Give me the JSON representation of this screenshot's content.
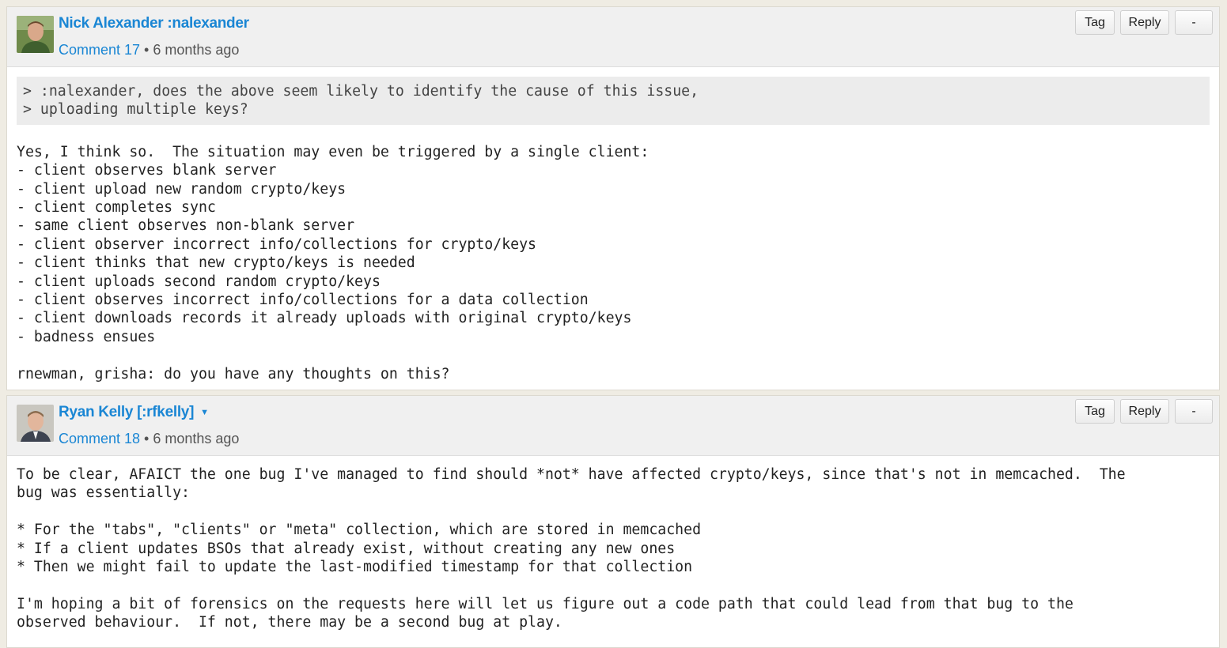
{
  "comments": [
    {
      "author": "Nick Alexander :nalexander",
      "has_menu": false,
      "comment_link": "Comment 17",
      "time": "6 months ago",
      "buttons": {
        "tag": "Tag",
        "reply": "Reply",
        "collapse": "-"
      },
      "quote": "> :nalexander, does the above seem likely to identify the cause of this issue,\n> uploading multiple keys?",
      "text": "Yes, I think so.  The situation may even be triggered by a single client:\n- client observes blank server\n- client upload new random crypto/keys\n- client completes sync\n- same client observes non-blank server\n- client observer incorrect info/collections for crypto/keys\n- client thinks that new crypto/keys is needed\n- client uploads second random crypto/keys\n- client observes incorrect info/collections for a data collection\n- client downloads records it already uploads with original crypto/keys\n- badness ensues\n\nrnewman, grisha: do you have any thoughts on this?"
    },
    {
      "author": "Ryan Kelly [:rfkelly]",
      "has_menu": true,
      "menu_glyph": "▼",
      "comment_link": "Comment 18",
      "time": "6 months ago",
      "buttons": {
        "tag": "Tag",
        "reply": "Reply",
        "collapse": "-"
      },
      "text": "To be clear, AFAICT the one bug I've managed to find should *not* have affected crypto/keys, since that's not in memcached.  The\nbug was essentially:\n\n* For the \"tabs\", \"clients\" or \"meta\" collection, which are stored in memcached\n* If a client updates BSOs that already exist, without creating any new ones\n* Then we might fail to update the last-modified timestamp for that collection\n\nI'm hoping a bit of forensics on the requests here will let us figure out a code path that could lead from that bug to the\nobserved behaviour.  If not, there may be a second bug at play."
    }
  ],
  "separator": "•",
  "colors": {
    "link": "#1a86d4",
    "header_bg": "#f0f0f0",
    "page_bg": "#efece3",
    "quote_bg": "#ececec"
  }
}
